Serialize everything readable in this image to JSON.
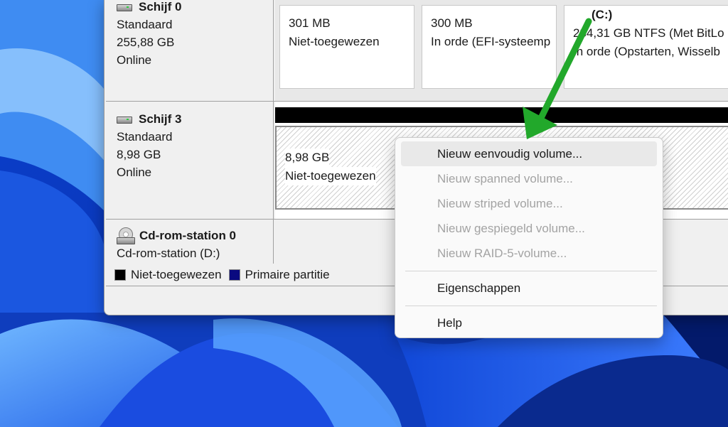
{
  "colors": {
    "unallocated": "#000000",
    "primary_partition": "#0a0a80",
    "arrow": "#22a82b",
    "wallpaper": "#1a4fd6"
  },
  "disks": [
    {
      "name": "Schijf 0",
      "type": "Standaard",
      "size": "255,88 GB",
      "status": "Online",
      "partitions": [
        {
          "size": "301 MB",
          "status": "Niet-toegewezen"
        },
        {
          "size": "300 MB",
          "status": "In orde (EFI-systeemp"
        },
        {
          "size": "(C:)",
          "detail": "234,31 GB NTFS (Met BitLo",
          "status": "In orde (Opstarten, Wisselb"
        }
      ]
    },
    {
      "name": "Schijf 3",
      "type": "Standaard",
      "size": "8,98 GB",
      "status": "Online",
      "partitions": [
        {
          "size": "8,98 GB",
          "status": "Niet-toegewezen"
        }
      ]
    },
    {
      "name": "Cd-rom-station 0",
      "drive": "Cd-rom-station (D:)"
    }
  ],
  "legend": {
    "unallocated": "Niet-toegewezen",
    "primary": "Primaire partitie"
  },
  "context_menu": {
    "items": [
      {
        "label": "Nieuw eenvoudig volume...",
        "enabled": true
      },
      {
        "label": "Nieuw spanned volume...",
        "enabled": false
      },
      {
        "label": "Nieuw striped volume...",
        "enabled": false
      },
      {
        "label": "Nieuw gespiegeld volume...",
        "enabled": false
      },
      {
        "label": "Nieuw RAID-5-volume...",
        "enabled": false
      },
      {
        "label": "Eigenschappen",
        "enabled": true
      },
      {
        "label": "Help",
        "enabled": true
      }
    ]
  }
}
